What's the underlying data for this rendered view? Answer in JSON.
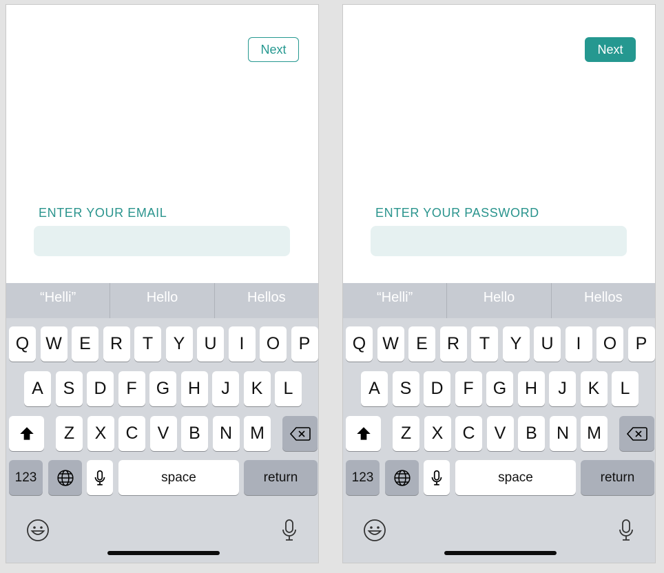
{
  "screens": [
    {
      "id": "left",
      "next_label": "Next",
      "next_style": "outline",
      "field_label": "ENTER YOUR EMAIL",
      "field_value": ""
    },
    {
      "id": "right",
      "next_label": "Next",
      "next_style": "filled",
      "field_label": "ENTER YOUR PASSWORD",
      "field_value": ""
    }
  ],
  "keyboard": {
    "suggestions": [
      "“Helli”",
      "Hello",
      "Hellos"
    ],
    "row1": [
      "Q",
      "W",
      "E",
      "R",
      "T",
      "Y",
      "U",
      "I",
      "O",
      "P"
    ],
    "row2": [
      "A",
      "S",
      "D",
      "F",
      "G",
      "H",
      "J",
      "K",
      "L"
    ],
    "row3": [
      "Z",
      "X",
      "C",
      "V",
      "B",
      "N",
      "M"
    ],
    "numbers_label": "123",
    "space_label": "space",
    "return_label": "return",
    "icons": {
      "shift": "shift-icon",
      "delete": "delete-icon",
      "globe": "globe-icon",
      "mic": "microphone-icon",
      "emoji": "emoji-icon",
      "dictation": "dictation-microphone-icon"
    }
  },
  "colors": {
    "accent": "#259890",
    "input_bg": "#e6f1f1",
    "keyboard_bg": "#d4d7dc",
    "key_dark": "#abb0ba"
  }
}
